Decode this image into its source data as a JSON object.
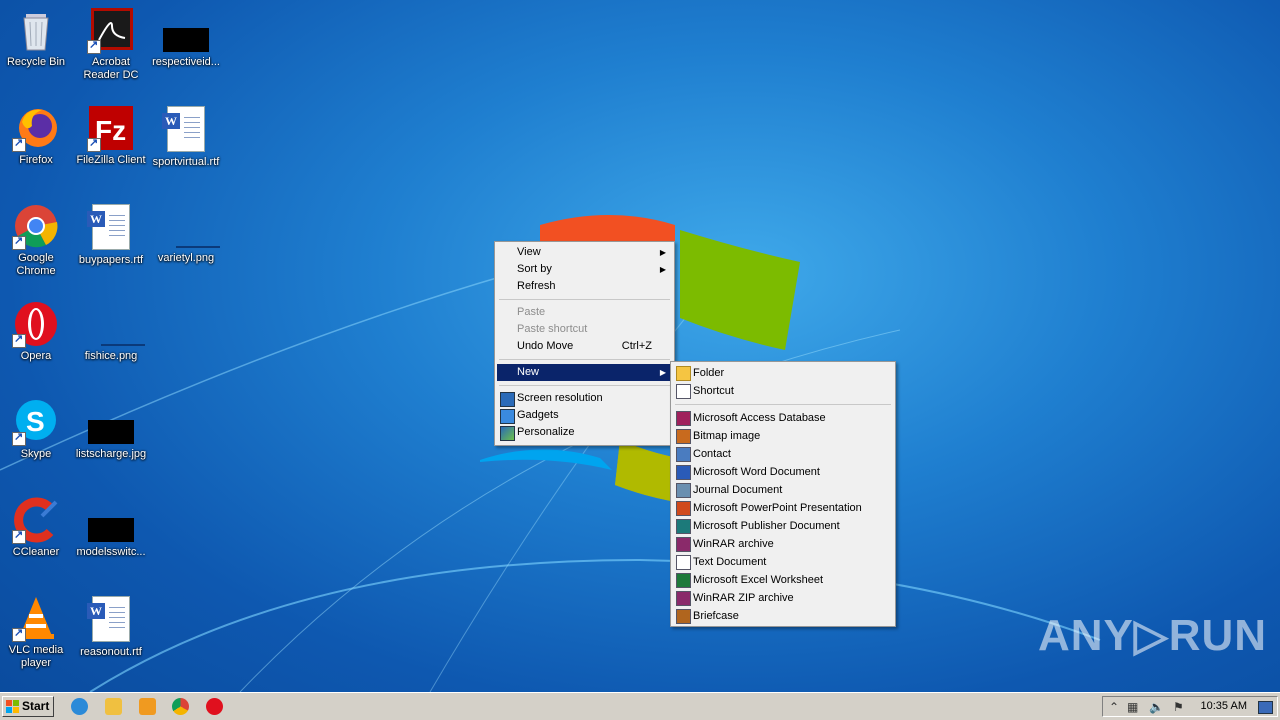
{
  "desktop_icons": [
    {
      "label": "Recycle Bin"
    },
    {
      "label": "Acrobat Reader DC"
    },
    {
      "label": "respectiveid..."
    },
    {
      "label": "Firefox"
    },
    {
      "label": "FileZilla Client"
    },
    {
      "label": "sportvirtual.rtf"
    },
    {
      "label": "Google Chrome"
    },
    {
      "label": "buypapers.rtf"
    },
    {
      "label": "varietyl.png"
    },
    {
      "label": "Opera"
    },
    {
      "label": "fishice.png"
    },
    {
      "label": "Skype"
    },
    {
      "label": "listscharge.jpg"
    },
    {
      "label": "CCleaner"
    },
    {
      "label": "modelsswitc..."
    },
    {
      "label": "VLC media player"
    },
    {
      "label": "reasonout.rtf"
    }
  ],
  "context_menu": {
    "view": "View",
    "sort_by": "Sort by",
    "refresh": "Refresh",
    "paste": "Paste",
    "paste_shortcut": "Paste shortcut",
    "undo_move": "Undo Move",
    "undo_shortcut": "Ctrl+Z",
    "new": "New",
    "screen_resolution": "Screen resolution",
    "gadgets": "Gadgets",
    "personalize": "Personalize"
  },
  "new_submenu": {
    "folder": "Folder",
    "shortcut": "Shortcut",
    "items": [
      {
        "label": "Microsoft Access Database",
        "icon": "access-icon",
        "color": "#a0215c"
      },
      {
        "label": "Bitmap image",
        "icon": "bitmap-icon",
        "color": "#c86a1e"
      },
      {
        "label": "Contact",
        "icon": "contact-icon",
        "color": "#4a7cc0"
      },
      {
        "label": "Microsoft Word Document",
        "icon": "word-icon",
        "color": "#2a5bb8"
      },
      {
        "label": "Journal Document",
        "icon": "journal-icon",
        "color": "#6a8fb0"
      },
      {
        "label": "Microsoft PowerPoint Presentation",
        "icon": "powerpoint-icon",
        "color": "#d04a1c"
      },
      {
        "label": "Microsoft Publisher Document",
        "icon": "publisher-icon",
        "color": "#1c7a7a"
      },
      {
        "label": "WinRAR archive",
        "icon": "winrar-icon",
        "color": "#8a2a6a"
      },
      {
        "label": "Text Document",
        "icon": "text-document-icon",
        "color": "#ffffff"
      },
      {
        "label": "Microsoft Excel Worksheet",
        "icon": "excel-icon",
        "color": "#1e7a3a"
      },
      {
        "label": "WinRAR ZIP archive",
        "icon": "winrar-zip-icon",
        "color": "#8a2a6a"
      },
      {
        "label": "Briefcase",
        "icon": "briefcase-icon",
        "color": "#b0651e"
      }
    ]
  },
  "taskbar": {
    "start_label": "Start",
    "clock": "10:35 AM"
  },
  "watermark": "ANY▷RUN"
}
